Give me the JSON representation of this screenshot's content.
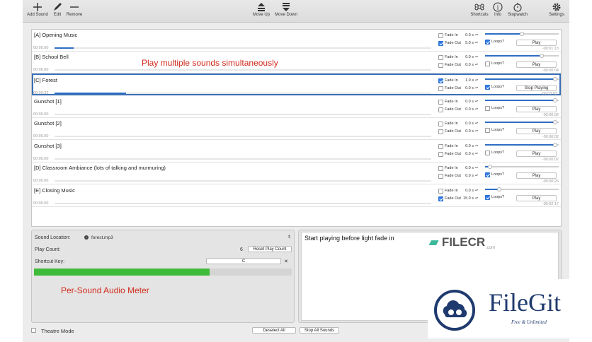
{
  "toolbar": {
    "add_sound": "Add Sound",
    "edit": "Edit",
    "remove": "Remove",
    "move_up": "Move Up",
    "move_down": "Move Down",
    "shortcuts": "Shortcuts",
    "info": "Info",
    "stopwatch": "Stopwatch",
    "settings": "Settings"
  },
  "labels": {
    "fade_in": "Fade In",
    "fade_out": "Fade Out",
    "loops": "Loops?"
  },
  "sounds": [
    {
      "name": "[A] Opening Music",
      "elapsed": "00:00.00",
      "remaining": "-00:01:13",
      "fade_in": false,
      "fade_out": true,
      "fade_in_val": "0.0 s",
      "fade_out_val": "5.0 s",
      "loops": true,
      "volume": 0.5,
      "progress": 0.05,
      "button": "Play",
      "selected": false
    },
    {
      "name": "[B] School Bell",
      "elapsed": "00:00.00",
      "remaining": "-00:00:04",
      "fade_in": false,
      "fade_out": false,
      "fade_in_val": "0.0 s",
      "fade_out_val": "0.0 s",
      "loops": false,
      "volume": 0.79,
      "progress": 0,
      "button": "Play",
      "selected": false
    },
    {
      "name": "[C] Forest",
      "elapsed": "00:00:32",
      "remaining": "-00:03:03",
      "fade_in": true,
      "fade_out": false,
      "fade_in_val": "1.0 s",
      "fade_out_val": "0.0 s",
      "loops": true,
      "volume": 0.98,
      "progress": 0.19,
      "button": "Stop Playing",
      "selected": true
    },
    {
      "name": "Gunshot [1]",
      "elapsed": "00:00.00",
      "remaining": "-00:00:02",
      "fade_in": false,
      "fade_out": false,
      "fade_in_val": "0.0 s",
      "fade_out_val": "0.0 s",
      "loops": false,
      "volume": 0.98,
      "progress": 0,
      "button": "Play",
      "selected": false
    },
    {
      "name": "Gunshot [2]",
      "elapsed": "00:00.00",
      "remaining": "-00:00:02",
      "fade_in": false,
      "fade_out": false,
      "fade_in_val": "0.0 s",
      "fade_out_val": "0.0 s",
      "loops": false,
      "volume": 0.98,
      "progress": 0,
      "button": "Play",
      "selected": false
    },
    {
      "name": "Gunshot [3]",
      "elapsed": "00:00.00",
      "remaining": "-00:00:02",
      "fade_in": false,
      "fade_out": false,
      "fade_in_val": "0.0 s",
      "fade_out_val": "0.0 s",
      "loops": false,
      "volume": 0.98,
      "progress": 0,
      "button": "Play",
      "selected": false
    },
    {
      "name": "[D] Classroom Ambiance (lots of talking and murmuring)",
      "elapsed": "00:00.00",
      "remaining": "-00:00:26",
      "fade_in": false,
      "fade_out": false,
      "fade_in_val": "0.0 s",
      "fade_out_val": "0.0 s",
      "loops": true,
      "volume": 0.04,
      "progress": 0,
      "button": "Play",
      "selected": false
    },
    {
      "name": "[E] Closing Music",
      "elapsed": "00:00.00",
      "remaining": "-00:02:17",
      "fade_in": false,
      "fade_out": true,
      "fade_in_val": "0.0 s",
      "fade_out_val": "15.0 s",
      "loops": true,
      "volume": 0.17,
      "progress": 0,
      "button": "Play",
      "selected": false
    }
  ],
  "detail": {
    "sound_location_label": "Sound Location:",
    "sound_location_value": "forest.mp3",
    "play_count_label": "Play Count:",
    "play_count_value": "6",
    "reset_play_count": "Reset Play Count",
    "shortcut_key_label": "Shortcut Key:",
    "shortcut_key_value": "C",
    "clear": "✕",
    "meter_level": 0.68,
    "notes": "Start playing before light fade in"
  },
  "footer": {
    "theatre_mode": "Theatre Mode",
    "deselect_all": "Deselect All",
    "stop_all_sounds": "Stop All Sounds"
  },
  "annotations": {
    "play_multiple": "Play multiple sounds simultaneously",
    "audio_meter": "Per-Sound Audio Meter"
  },
  "watermarks": {
    "filecr": "FILECR",
    "filecr_sub": ".com",
    "filegit": "FileGit",
    "filegit_sub": "Free & Unlimited"
  },
  "colors": {
    "accent": "#2d6ec4",
    "meter": "#3fbb3a",
    "annotation": "#d02a1c",
    "filegit": "#1f3a6e"
  }
}
